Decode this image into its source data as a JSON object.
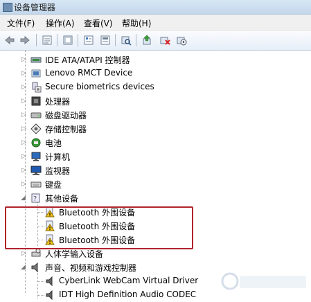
{
  "window": {
    "title": "设备管理器"
  },
  "menu": [
    {
      "label": "文件(F)"
    },
    {
      "label": "操作(A)"
    },
    {
      "label": "查看(V)"
    },
    {
      "label": "帮助(H)"
    }
  ],
  "toolbar": {
    "buttons": [
      "back-arrow-icon",
      "forward-arrow-icon",
      "properties-icon",
      "help-book-icon",
      "device-list-icon",
      "scan-hardware-icon",
      "update-driver-icon",
      "uninstall-icon",
      "disable-icon"
    ]
  },
  "tree": [
    {
      "label": "IDE ATA/ATAPI 控制器",
      "icon": "ide-controller-icon",
      "expanded": false
    },
    {
      "label": "Lenovo RMCT Device",
      "icon": "device-icon",
      "expanded": false
    },
    {
      "label": "Secure biometrics devices",
      "icon": "biometric-icon",
      "expanded": false
    },
    {
      "label": "处理器",
      "icon": "processor-icon",
      "expanded": false
    },
    {
      "label": "磁盘驱动器",
      "icon": "disk-drive-icon",
      "expanded": false
    },
    {
      "label": "存储控制器",
      "icon": "storage-controller-icon",
      "expanded": false
    },
    {
      "label": "电池",
      "icon": "battery-icon",
      "expanded": false
    },
    {
      "label": "计算机",
      "icon": "computer-icon",
      "expanded": false
    },
    {
      "label": "监视器",
      "icon": "monitor-icon",
      "expanded": false
    },
    {
      "label": "键盘",
      "icon": "keyboard-icon",
      "expanded": false
    },
    {
      "label": "其他设备",
      "icon": "other-devices-icon",
      "expanded": true,
      "children": [
        {
          "label": "Bluetooth 外围设备",
          "icon": "warning-device-icon"
        },
        {
          "label": "Bluetooth 外围设备",
          "icon": "warning-device-icon"
        },
        {
          "label": "Bluetooth 外围设备",
          "icon": "warning-device-icon"
        }
      ]
    },
    {
      "label": "人体学输入设备",
      "icon": "hid-icon",
      "expanded": false
    },
    {
      "label": "声音、视频和游戏控制器",
      "icon": "sound-icon",
      "expanded": true,
      "children": [
        {
          "label": "CyberLink WebCam Virtual Driver",
          "icon": "speaker-icon"
        },
        {
          "label": "IDT High Definition Audio CODEC",
          "icon": "speaker-icon"
        }
      ]
    }
  ],
  "colors": {
    "highlight_box": "#b0242c",
    "warning": "#f2c21a"
  }
}
